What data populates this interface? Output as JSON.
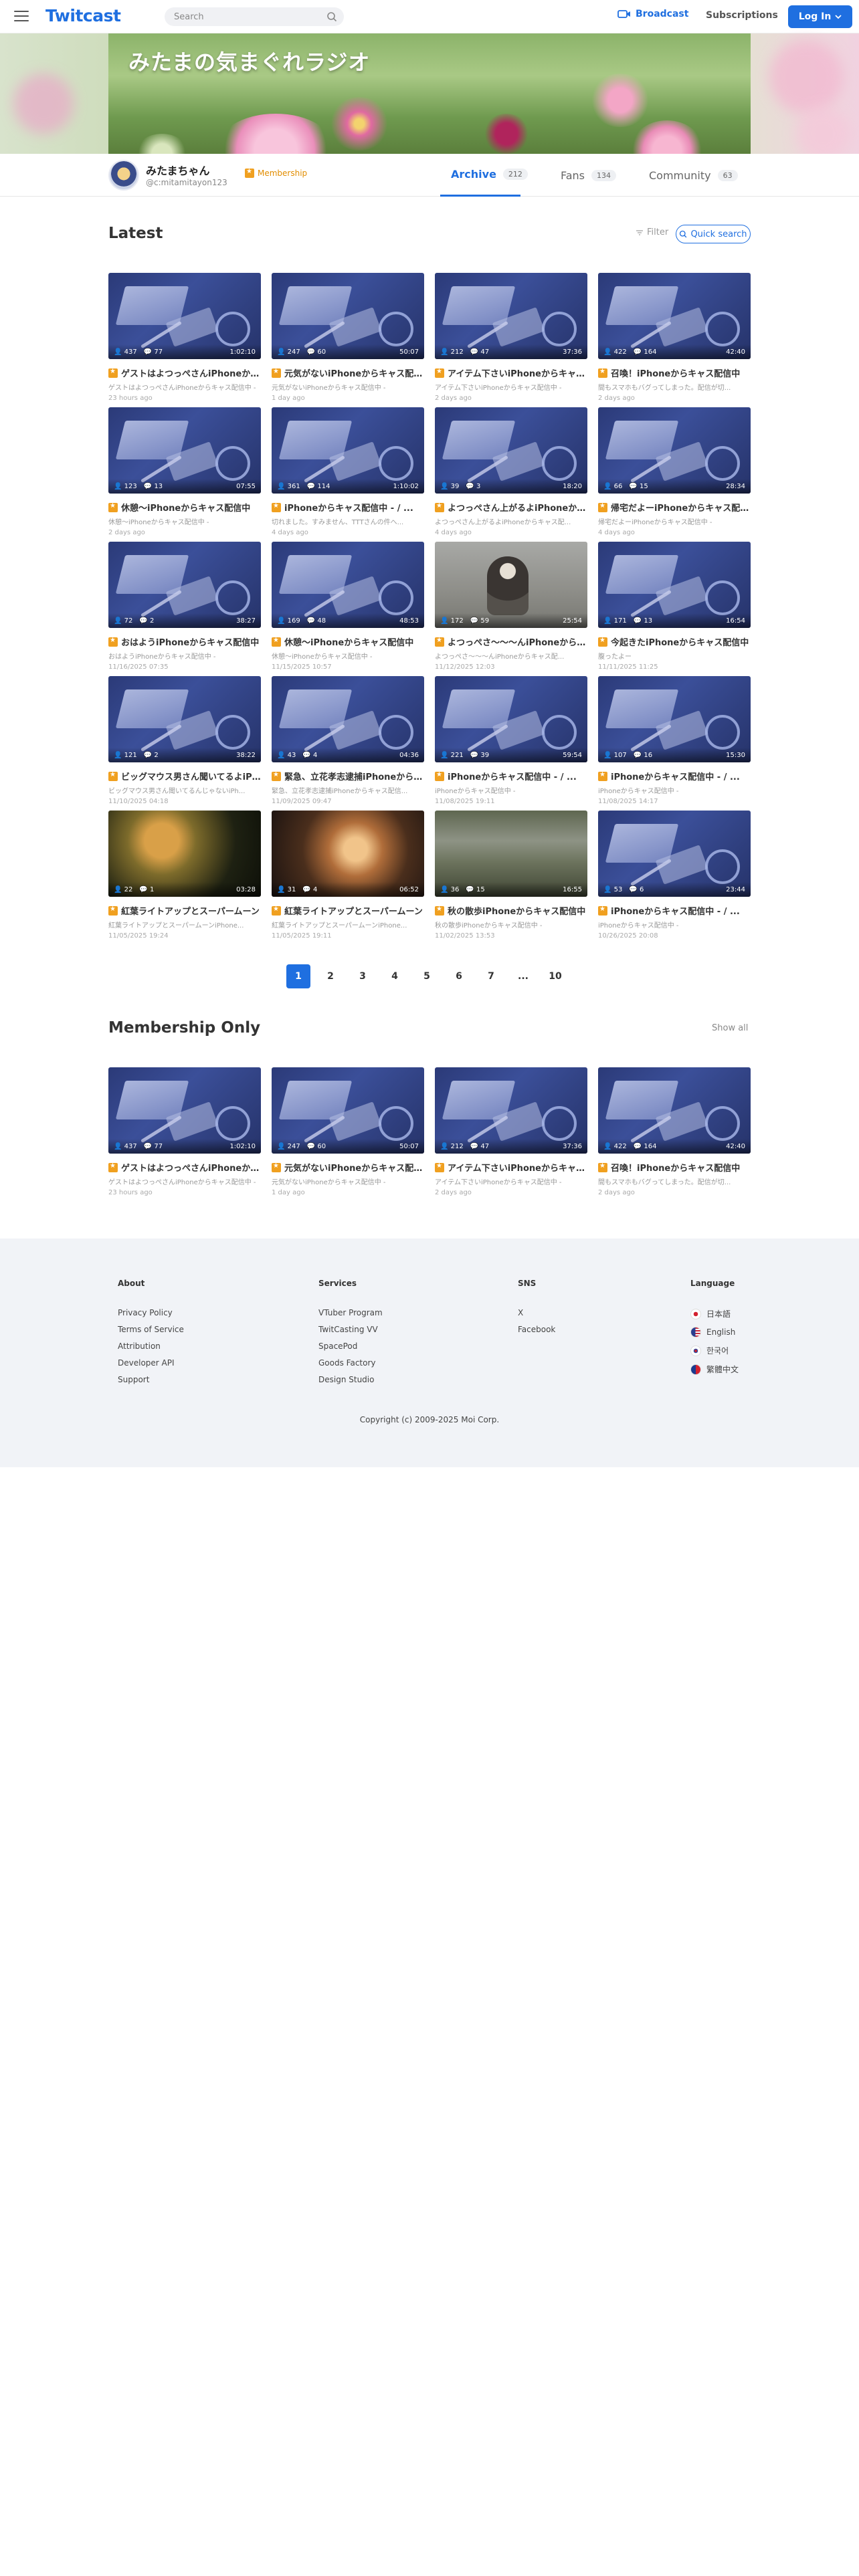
{
  "header": {
    "logo": "Twitcast",
    "search_placeholder": "Search",
    "broadcast": "Broadcast",
    "subscriptions": "Subscriptions",
    "login": "Log In"
  },
  "banner": {
    "title": "みたまの気まぐれラジオ"
  },
  "profile": {
    "name": "みたまちゃん",
    "handle": "@c:mitamitayon123",
    "membership": "Membership",
    "tabs": [
      {
        "label": "Archive",
        "count": "212"
      },
      {
        "label": "Fans",
        "count": "134"
      },
      {
        "label": "Community",
        "count": "63"
      }
    ]
  },
  "latest": {
    "title": "Latest",
    "filter": "Filter",
    "quick_search": "Quick search",
    "videos": [
      {
        "viewers": "437",
        "comments": "77",
        "duration": "1:02:10",
        "title": "ゲストはよつっぺさんiPhoneからキャス配信",
        "sub": "ゲストはよつっぺさんiPhoneからキャス配信中 -",
        "when": "23 hours ago",
        "thumb": "desk"
      },
      {
        "viewers": "247",
        "comments": "60",
        "duration": "50:07",
        "title": "元気がないiPhoneからキャス配信中",
        "sub": "元気がないiPhoneからキャス配信中 -",
        "when": "1 day ago",
        "thumb": "desk"
      },
      {
        "viewers": "212",
        "comments": "47",
        "duration": "37:36",
        "title": "アイテム下さいiPhoneからキャス配信中",
        "sub": "アイテム下さいiPhoneからキャス配信中 -",
        "when": "2 days ago",
        "thumb": "desk"
      },
      {
        "viewers": "422",
        "comments": "164",
        "duration": "42:40",
        "title": "召喚！iPhoneからキャス配信中",
        "sub": "間もスマホもバグってしまった。配信が切...",
        "when": "2 days ago",
        "thumb": "desk"
      },
      {
        "viewers": "123",
        "comments": "13",
        "duration": "07:55",
        "title": "休憩〜iPhoneからキャス配信中",
        "sub": "休憩〜iPhoneからキャス配信中 -",
        "when": "2 days ago",
        "thumb": "desk"
      },
      {
        "viewers": "361",
        "comments": "114",
        "duration": "1:10:02",
        "title": "iPhoneからキャス配信中 - / ...",
        "sub": "切れました。すみません、TTTさんの件へ...",
        "when": "4 days ago",
        "thumb": "desk"
      },
      {
        "viewers": "39",
        "comments": "3",
        "duration": "18:20",
        "title": "よつっぺさん上がるよiPhoneからキャス配信",
        "sub": "よつっぺさん上がるよiPhoneからキャス配...",
        "when": "4 days ago",
        "thumb": "desk"
      },
      {
        "viewers": "66",
        "comments": "15",
        "duration": "28:34",
        "title": "帰宅だよーiPhoneからキャス配信中",
        "sub": "帰宅だよーiPhoneからキャス配信中 -",
        "when": "4 days ago",
        "thumb": "desk"
      },
      {
        "viewers": "72",
        "comments": "2",
        "duration": "38:27",
        "title": "おはようiPhoneからキャス配信中",
        "sub": "おはようiPhoneからキャス配信中 -",
        "when": "11/16/2025 07:35",
        "thumb": "desk"
      },
      {
        "viewers": "169",
        "comments": "48",
        "duration": "48:53",
        "title": "休憩〜iPhoneからキャス配信中",
        "sub": "休憩〜iPhoneからキャス配信中 -",
        "when": "11/15/2025 10:57",
        "thumb": "desk"
      },
      {
        "viewers": "172",
        "comments": "59",
        "duration": "25:54",
        "title": "よつっぺさ〜〜〜んiPhoneからキャス配信",
        "sub": "よつっぺさ〜〜〜んiPhoneからキャス配...",
        "when": "11/12/2025 12:03",
        "thumb": "person"
      },
      {
        "viewers": "171",
        "comments": "13",
        "duration": "16:54",
        "title": "今起きたiPhoneからキャス配信中",
        "sub": "腹ったよー",
        "when": "11/11/2025 11:25",
        "thumb": "desk"
      },
      {
        "viewers": "121",
        "comments": "2",
        "duration": "38:22",
        "title": "ビッグマウス男さん聞いてるよiPhoneから",
        "sub": "ビッグマウス男さん聞いてるんじゃないiPh...",
        "when": "11/10/2025 04:18",
        "thumb": "desk"
      },
      {
        "viewers": "43",
        "comments": "4",
        "duration": "04:36",
        "title": "緊急、立花孝志逮捕iPhoneからキャス配信",
        "sub": "緊急、立花孝志逮捕iPhoneからキャス配信...",
        "when": "11/09/2025 09:47",
        "thumb": "desk"
      },
      {
        "viewers": "221",
        "comments": "39",
        "duration": "59:54",
        "title": "iPhoneからキャス配信中 - / ...",
        "sub": "iPhoneからキャス配信中 -",
        "when": "11/08/2025 19:11",
        "thumb": "desk"
      },
      {
        "viewers": "107",
        "comments": "16",
        "duration": "15:30",
        "title": "iPhoneからキャス配信中 - / ...",
        "sub": "iPhoneからキャス配信中 -",
        "when": "11/08/2025 14:17",
        "thumb": "desk"
      },
      {
        "viewers": "22",
        "comments": "1",
        "duration": "03:28",
        "title": "紅葉ライトアップとスーパームーン",
        "sub": "紅葉ライトアップとスーパームーンiPhone...",
        "when": "11/05/2025 19:24",
        "thumb": "night"
      },
      {
        "viewers": "31",
        "comments": "4",
        "duration": "06:52",
        "title": "紅葉ライトアップとスーパームーン",
        "sub": "紅葉ライトアップとスーパームーンiPhone...",
        "when": "11/05/2025 19:11",
        "thumb": "autumn"
      },
      {
        "viewers": "36",
        "comments": "15",
        "duration": "16:55",
        "title": "秋の散歩iPhoneからキャス配信中",
        "sub": "秋の散歩iPhoneからキャス配信中 -",
        "when": "11/02/2025 13:53",
        "thumb": "path"
      },
      {
        "viewers": "53",
        "comments": "6",
        "duration": "23:44",
        "title": "iPhoneからキャス配信中 - / ...",
        "sub": "iPhoneからキャス配信中 -",
        "when": "10/26/2025 20:08",
        "thumb": "desk"
      }
    ]
  },
  "pagination": [
    "1",
    "2",
    "3",
    "4",
    "5",
    "6",
    "7",
    "...",
    "10"
  ],
  "membership_only": {
    "title": "Membership Only",
    "show_all": "Show all",
    "videos": [
      {
        "viewers": "437",
        "comments": "77",
        "duration": "1:02:10",
        "title": "ゲストはよつっぺさんiPhoneからキャス配信",
        "sub": "ゲストはよつっぺさんiPhoneからキャス配信中 -",
        "when": "23 hours ago",
        "thumb": "desk"
      },
      {
        "viewers": "247",
        "comments": "60",
        "duration": "50:07",
        "title": "元気がないiPhoneからキャス配信中",
        "sub": "元気がないiPhoneからキャス配信中 -",
        "when": "1 day ago",
        "thumb": "desk"
      },
      {
        "viewers": "212",
        "comments": "47",
        "duration": "37:36",
        "title": "アイテム下さいiPhoneからキャス配信中",
        "sub": "アイテム下さいiPhoneからキャス配信中 -",
        "when": "2 days ago",
        "thumb": "desk"
      },
      {
        "viewers": "422",
        "comments": "164",
        "duration": "42:40",
        "title": "召喚！iPhoneからキャス配信中",
        "sub": "間もスマホもバグってしまった。配信が切...",
        "when": "2 days ago",
        "thumb": "desk"
      }
    ]
  },
  "footer": {
    "about": {
      "title": "About",
      "links": [
        "Privacy Policy",
        "Terms of Service",
        "Attribution",
        "Developer API",
        "Support"
      ]
    },
    "services": {
      "title": "Services",
      "links": [
        "VTuber Program",
        "TwitCasting VV",
        "SpacePod",
        "Goods Factory",
        "Design Studio"
      ]
    },
    "sns": {
      "title": "SNS",
      "links": [
        "X",
        "Facebook"
      ]
    },
    "language": {
      "title": "Language",
      "links": [
        "日本語",
        "English",
        "한국어",
        "繁體中文"
      ]
    },
    "copyright": "Copyright (c) 2009-2025 Moi Corp."
  },
  "colors": {
    "accent": "#1f6fe0",
    "membership": "#e28d00"
  }
}
